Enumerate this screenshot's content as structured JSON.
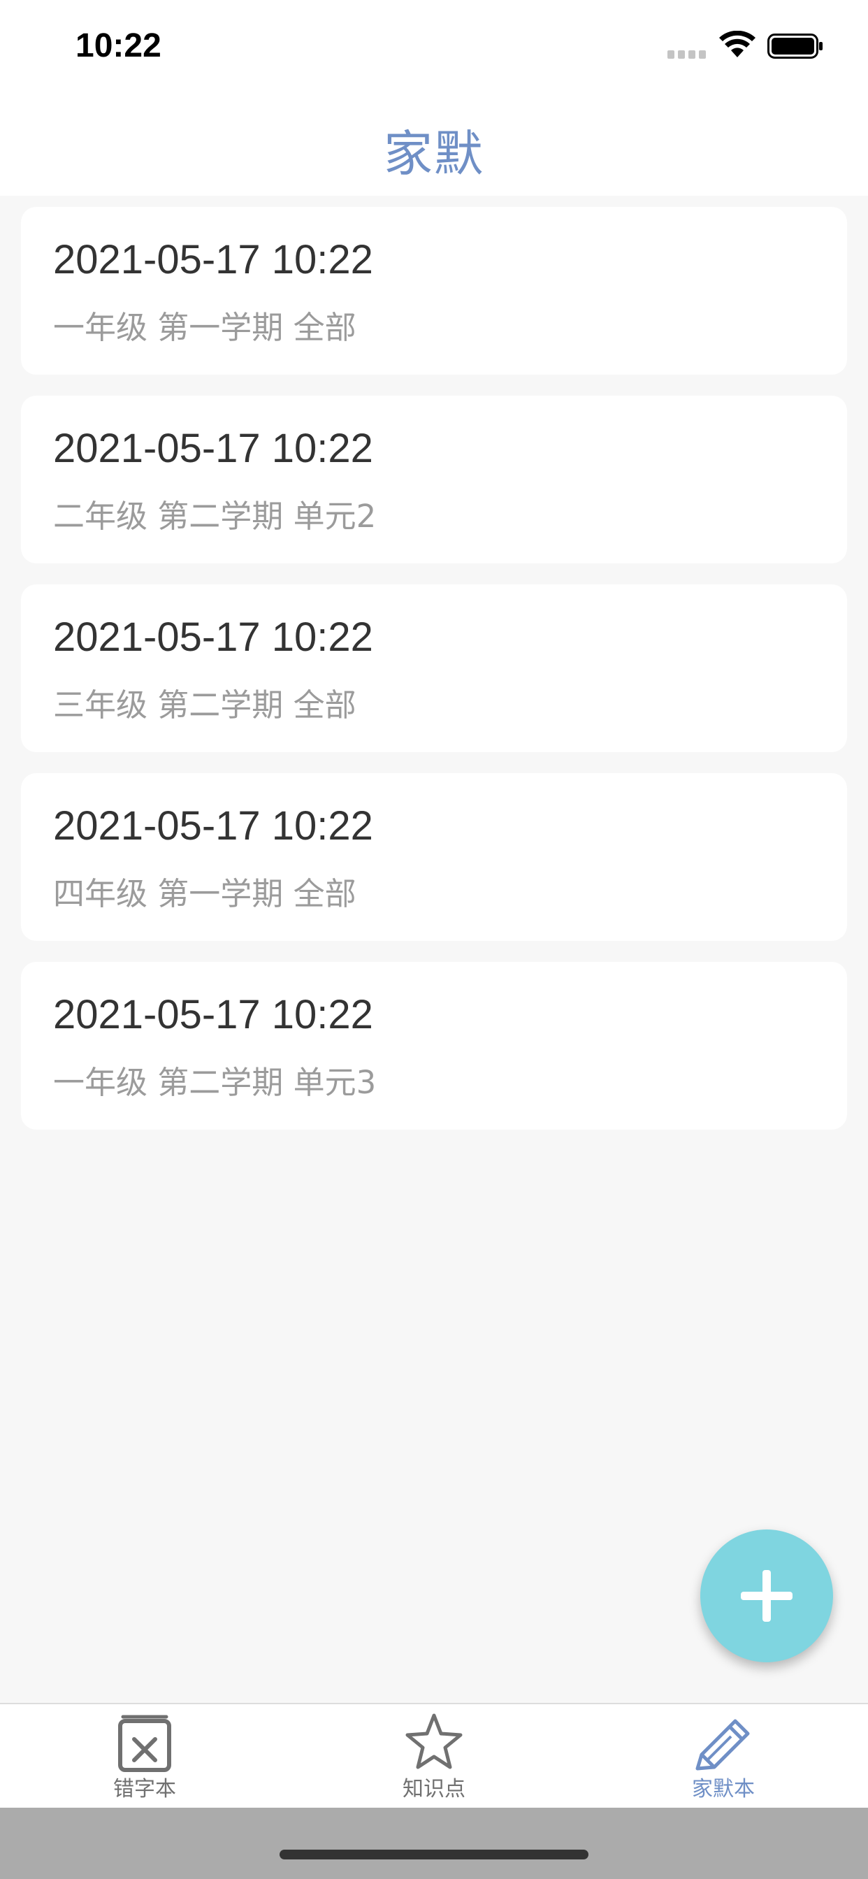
{
  "status_bar": {
    "time": "10:22"
  },
  "nav": {
    "title": "家默"
  },
  "records": [
    {
      "date": "2021-05-17 10:22",
      "subtitle": "一年级 第一学期 全部"
    },
    {
      "date": "2021-05-17 10:22",
      "subtitle": "二年级 第二学期 单元2"
    },
    {
      "date": "2021-05-17 10:22",
      "subtitle": "三年级 第二学期 全部"
    },
    {
      "date": "2021-05-17 10:22",
      "subtitle": "四年级 第一学期 全部"
    },
    {
      "date": "2021-05-17 10:22",
      "subtitle": "一年级 第二学期 单元3"
    }
  ],
  "fab": {
    "icon": "plus-icon"
  },
  "tabs": [
    {
      "label": "错字本",
      "icon": "mistake-book-icon",
      "active": false
    },
    {
      "label": "知识点",
      "icon": "star-icon",
      "active": false
    },
    {
      "label": "家默本",
      "icon": "pencil-icon",
      "active": true
    }
  ],
  "colors": {
    "accent": "#6f8fc6",
    "fab": "#7fd5e0",
    "background": "#f7f7f7",
    "inactive_tab": "#707070"
  }
}
